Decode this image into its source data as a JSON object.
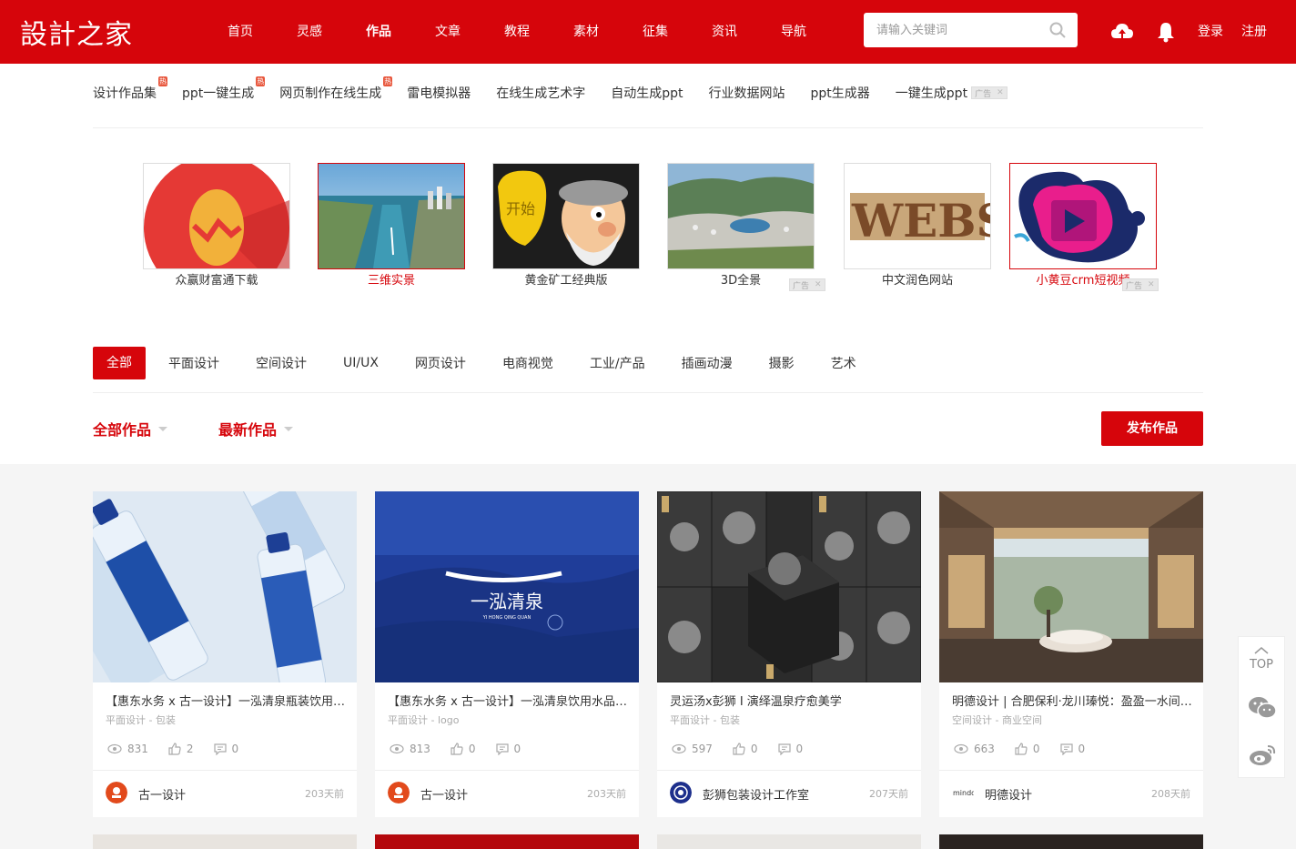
{
  "header": {
    "logo": "設計之家",
    "nav": [
      "首页",
      "灵感",
      "作品",
      "文章",
      "教程",
      "素材",
      "征集",
      "资讯",
      "导航"
    ],
    "active_nav": "作品",
    "search_placeholder": "请输入关键词",
    "login": "登录",
    "register": "注册"
  },
  "hotlinks": [
    {
      "label": "设计作品集",
      "hot": "热"
    },
    {
      "label": "ppt一键生成",
      "hot": "热"
    },
    {
      "label": "网页制作在线生成",
      "hot": "热"
    },
    {
      "label": "雷电模拟器",
      "hot": ""
    },
    {
      "label": "在线生成艺术字",
      "hot": ""
    },
    {
      "label": "自动生成ppt",
      "hot": ""
    },
    {
      "label": "行业数据网站",
      "hot": ""
    },
    {
      "label": "ppt生成器",
      "hot": ""
    },
    {
      "label": "一键生成ppt",
      "hot": ""
    }
  ],
  "ad_label": "广告",
  "ad_images": [
    {
      "caption": "众赢财富通下载",
      "highlight": false
    },
    {
      "caption": "三维实景",
      "highlight": true
    },
    {
      "caption": "黄金矿工经典版",
      "highlight": false
    },
    {
      "caption": "3D全景",
      "highlight": false
    },
    {
      "caption": "中文润色网站",
      "highlight": false
    },
    {
      "caption": "小黄豆crm短视频",
      "highlight": true
    }
  ],
  "categories": [
    "全部",
    "平面设计",
    "空间设计",
    "UI/UX",
    "网页设计",
    "电商视觉",
    "工业/产品",
    "插画动漫",
    "摄影",
    "艺术"
  ],
  "sort": {
    "filter1": "全部作品",
    "filter2": "最新作品",
    "publish": "发布作品"
  },
  "cards": [
    {
      "title": "【惠东水务 x 古一设计】一泓清泉瓶装饮用水包装设计",
      "sub": "平面设计 - 包装",
      "views": "831",
      "likes": "2",
      "comments": "0",
      "author": "古一设计",
      "time": "203天前"
    },
    {
      "title": "【惠东水务 x 古一设计】一泓清泉饮用水品牌logo设计",
      "sub": "平面设计 - logo",
      "views": "813",
      "likes": "0",
      "comments": "0",
      "author": "古一设计",
      "time": "203天前"
    },
    {
      "title": "灵运汤x彭狮 I 演绎温泉疗愈美学",
      "sub": "平面设计 - 包装",
      "views": "597",
      "likes": "0",
      "comments": "0",
      "author": "彭狮包装设计工作室",
      "time": "207天前"
    },
    {
      "title": "明德设计 | 合肥保利·龙川瑧悦：盈盈一水间，雅致如画境",
      "sub": "空间设计 - 商业空间",
      "views": "663",
      "likes": "0",
      "comments": "0",
      "author": "明德设计",
      "time": "208天前"
    }
  ],
  "side": {
    "top": "TOP"
  },
  "img_text": {
    "start": "开始",
    "websi": "WEBSI",
    "brand": "一泓清泉",
    "brand_en": "YI HONG QING QUAN",
    "mindd": "mindd"
  },
  "colors": {
    "brand": "#d6050b"
  }
}
